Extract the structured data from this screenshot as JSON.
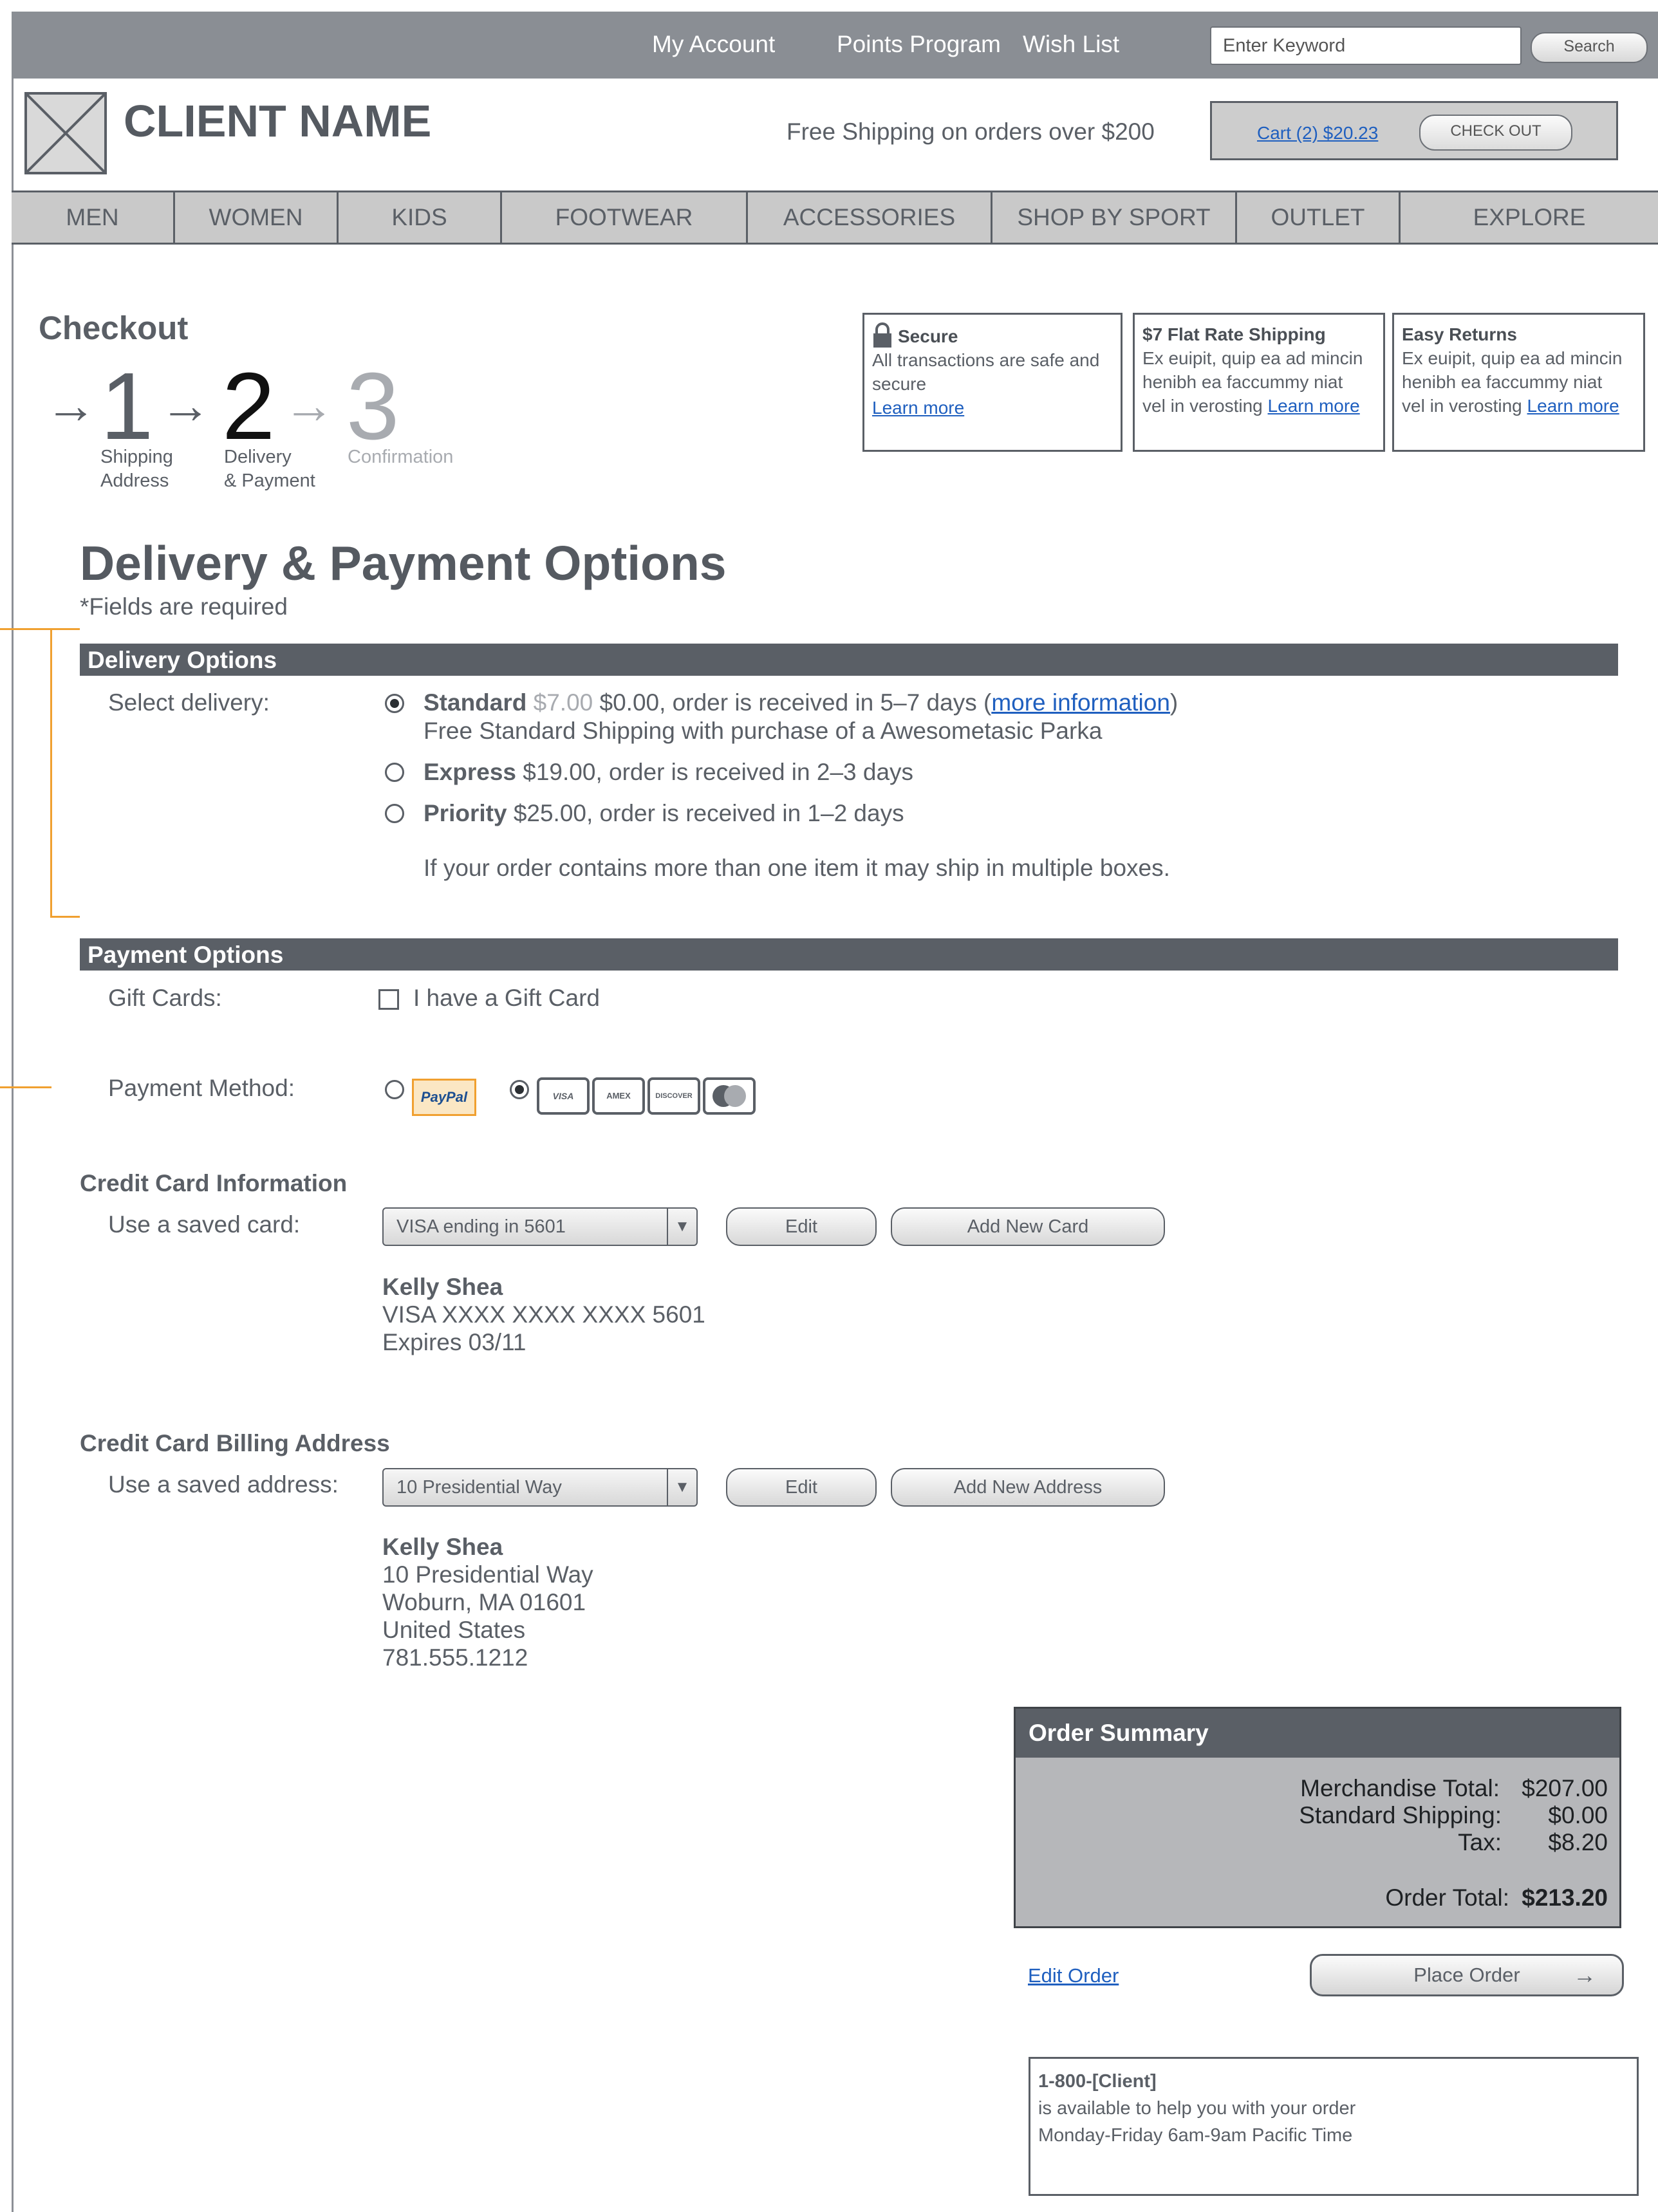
{
  "topbar": {
    "links": [
      "My Account",
      "Points Program",
      "Wish List"
    ],
    "search_placeholder": "Enter Keyword",
    "search_label": "Search"
  },
  "header": {
    "client_name": "CLIENT NAME",
    "free_shipping": "Free Shipping on orders over $200",
    "cart_link": "Cart (2) $20.23",
    "checkout_label": "CHECK OUT"
  },
  "nav": [
    "MEN",
    "WOMEN",
    "KIDS",
    "FOOTWEAR",
    "ACCESSORIES",
    "SHOP BY SPORT",
    "OUTLET",
    "EXPLORE"
  ],
  "checkout": {
    "title": "Checkout",
    "steps": [
      {
        "num": "1",
        "label1": "Shipping",
        "label2": "Address"
      },
      {
        "num": "2",
        "label1": "Delivery",
        "label2": "& Payment"
      },
      {
        "num": "3",
        "label1": "Confirmation",
        "label2": ""
      }
    ]
  },
  "info": {
    "secure_title": "Secure",
    "secure_text": "All transactions are safe and secure",
    "learn_more": "Learn more",
    "flat_title": "$7 Flat Rate Shipping",
    "flat_l1": "Ex euipit, quip ea ad mincin",
    "flat_l2": "henibh ea faccummy niat",
    "flat_l3": "vel in verosting",
    "returns_title": "Easy Returns",
    "returns_l1": "Ex euipit, quip ea ad mincin",
    "returns_l2": "henibh ea faccummy niat",
    "returns_l3": "vel in verosting"
  },
  "page": {
    "heading": "Delivery & Payment Options",
    "required_star": "*",
    "required_note": "Fields are required"
  },
  "delivery": {
    "section_title": "Delivery Options",
    "label": "Select delivery:",
    "standard_name": "Standard",
    "standard_old_price": "$7.00",
    "standard_text": "$0.00, order is received in 5–7 days (",
    "more_info": "more information",
    "close_paren": ")",
    "standard_note": "Free Standard Shipping with purchase of a Awesometasic  Parka",
    "express_name": "Express",
    "express_text": "$19.00, order is received in 2–3 days",
    "priority_name": "Priority",
    "priority_text": "$25.00, order is received in 1–2 days",
    "boxes_note": "If your order contains more than one item it may ship in multiple boxes."
  },
  "payment": {
    "section_title": "Payment Options",
    "gift_label": "Gift Cards:",
    "gift_checkbox": "I have a Gift Card",
    "method_label": "Payment Method:",
    "paypal": "PayPal",
    "cards": [
      "VISA",
      "AMEX",
      "DISCOVER"
    ]
  },
  "credit_card": {
    "heading": "Credit Card Information",
    "label": "Use a saved card:",
    "selected": "VISA ending in 5601",
    "edit": "Edit",
    "add_new": "Add New Card",
    "name": "Kelly Shea",
    "number": "VISA XXXX XXXX XXXX 5601",
    "expires": "Expires 03/11"
  },
  "billing": {
    "heading": "Credit Card Billing Address",
    "label": "Use a saved address:",
    "selected": "10 Presidential Way",
    "edit": "Edit",
    "add_new": "Add New Address",
    "name": "Kelly Shea",
    "street": "10 Presidential Way",
    "city": "Woburn, MA 01601",
    "country": "United States",
    "phone": "781.555.1212"
  },
  "summary": {
    "title": "Order Summary",
    "merch_label": "Merchandise Total:",
    "merch_value": "$207.00",
    "ship_label": "Standard Shipping:",
    "ship_value": "$0.00",
    "tax_label": "Tax:",
    "tax_value": "$8.20",
    "total_label": "Order Total:",
    "total_value": "$213.20"
  },
  "actions": {
    "edit_order": "Edit Order",
    "place_order": "Place Order"
  },
  "contact": {
    "phone": "1-800-[Client]",
    "line1": "is available to help you with your order",
    "line2": "Monday-Friday 6am-9am Pacific Time"
  },
  "colors": {
    "dark_bar": "#5a5f66",
    "topbar": "#8a8e94",
    "link": "#1f5fbf",
    "annotation": "#f0a030"
  }
}
